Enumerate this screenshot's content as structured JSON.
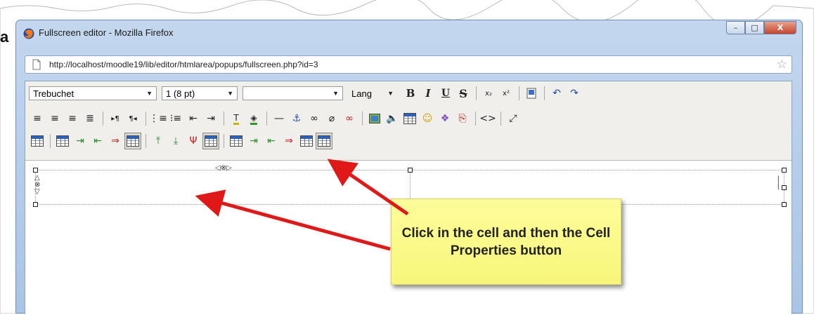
{
  "window": {
    "title": "Fullscreen editor - Mozilla Firefox",
    "minimize_label": "–",
    "maximize_label": "□",
    "close_label": "X"
  },
  "address_bar": {
    "url": "http://localhost/moodle19/lib/editor/htmlarea/popups/fullscreen.php?id=3",
    "bookmark_icon": "star-icon"
  },
  "toolbar": {
    "font_family": "Trebuchet",
    "font_size": "1 (8 pt)",
    "heading": "",
    "lang": "Lang",
    "bold": "B",
    "italic": "I",
    "underline": "U",
    "strikethrough": "S",
    "subscript": "x₂",
    "superscript": "x²",
    "row2_icons": [
      "justify-left-icon",
      "justify-center-icon",
      "justify-right-icon",
      "justify-full-icon",
      "ltr-icon",
      "rtl-icon",
      "ordered-list-icon",
      "unordered-list-icon",
      "outdent-icon",
      "indent-icon",
      "text-color-icon",
      "background-color-icon",
      "horizontal-rule-icon",
      "anchor-icon",
      "link-icon",
      "unlink-icon",
      "no-link-icon",
      "insert-image-icon",
      "insert-media-icon",
      "insert-table-icon",
      "smiley-icon",
      "special-char-icon",
      "search-replace-icon",
      "html-source-icon",
      "fullscreen-icon"
    ],
    "row3_icons": [
      "table-properties-icon",
      "row-properties-icon",
      "insert-row-before-icon",
      "insert-row-after-icon",
      "delete-row-icon",
      "split-row-icon",
      "insert-col-before-icon",
      "insert-col-after-icon",
      "delete-col-icon",
      "split-col-icon",
      "cell-properties-icon",
      "insert-cell-before-icon",
      "insert-cell-after-icon",
      "delete-cell-icon",
      "merge-cells-icon",
      "split-cell-icon"
    ]
  },
  "callout": {
    "text": "Click in the cell and then the Cell Properties button"
  },
  "colors": {
    "arrow": "#e01818",
    "callout_bg": "#f9f98a",
    "titlebar": "#b9cfec"
  }
}
